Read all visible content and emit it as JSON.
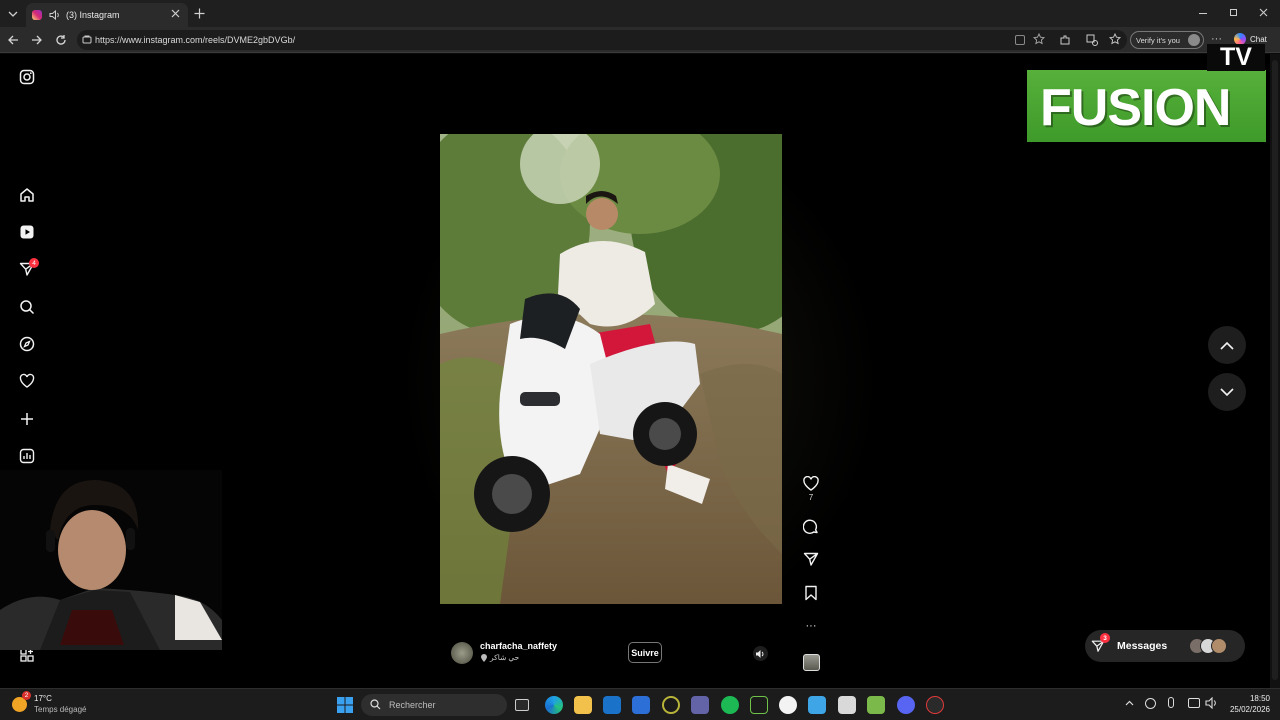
{
  "browser": {
    "tab_title": "(3) Instagram",
    "url": "https://www.instagram.com/reels/DVME2gbDVGb/",
    "verify_label": "Verify it's you",
    "chat_label": "Chat"
  },
  "sidebar": {
    "items": [
      {
        "name": "instagram-logo-icon"
      },
      {
        "name": "home-icon"
      },
      {
        "name": "reels-icon"
      },
      {
        "name": "messages-icon",
        "badge": "4"
      },
      {
        "name": "search-icon"
      },
      {
        "name": "explore-icon"
      },
      {
        "name": "heart-icon"
      },
      {
        "name": "create-icon"
      },
      {
        "name": "dashboard-icon"
      },
      {
        "name": "profile-avatar"
      },
      {
        "name": "more-icon"
      }
    ]
  },
  "reel": {
    "username": "charfacha_naffety",
    "location": "حي شاكر",
    "follow_label": "Suivre",
    "likes": "7"
  },
  "overlay": {
    "logo_text": "FUSION",
    "logo_tv": "TV"
  },
  "messages": {
    "label": "Messages",
    "badge": "3"
  },
  "taskbar": {
    "weather_temp": "17°C",
    "weather_desc": "Temps dégagé",
    "weather_badge": "2",
    "search_placeholder": "Rechercher",
    "time": "18:50",
    "date": "25/02/2026"
  },
  "colors": {
    "accent_badge": "#ff3040",
    "logo_green": "#4fa836"
  }
}
